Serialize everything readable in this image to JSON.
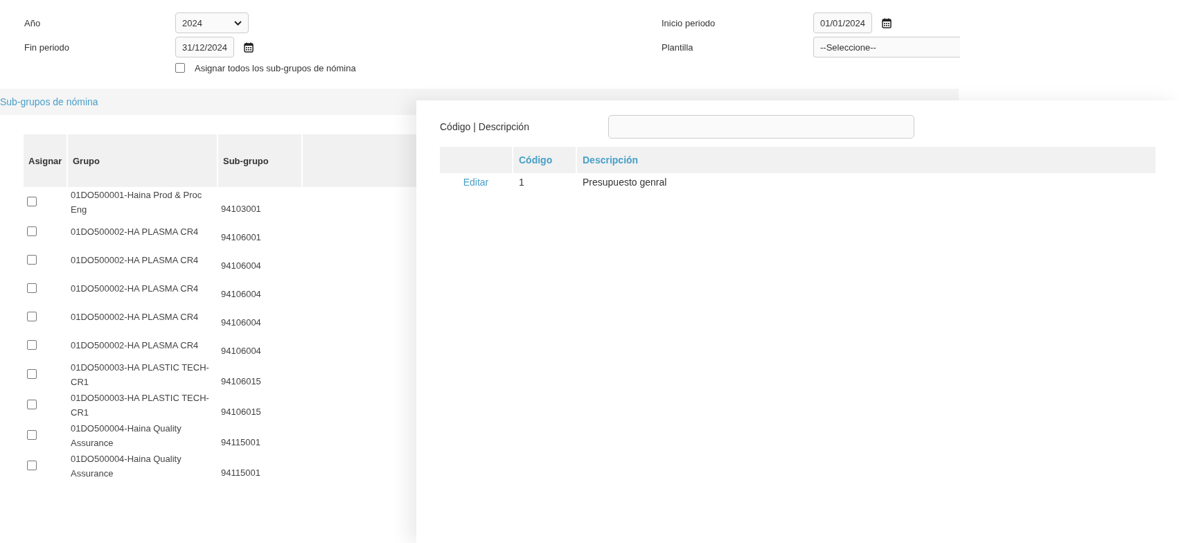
{
  "filters": {
    "year": {
      "label": "Año",
      "value": "2024"
    },
    "start": {
      "label": "Inicio periodo",
      "value": "01/01/2024"
    },
    "end": {
      "label": "Fin periodo",
      "value": "31/12/2024"
    },
    "template": {
      "label": "Plantilla",
      "value": "--Seleccione--"
    },
    "assign_all": {
      "label": "Asignar todos los sub-grupos de nómina",
      "checked": false
    }
  },
  "section": {
    "title": "Sub-grupos de nómina"
  },
  "sub_groups": {
    "columns": [
      "Asignar",
      "Grupo",
      "Sub-grupo"
    ],
    "rows": [
      {
        "checked": false,
        "group": "01DO500001-Haina Prod & Proc Eng",
        "subgroup": "94103001"
      },
      {
        "checked": false,
        "group": "01DO500002-HA PLASMA CR4",
        "subgroup": "94106001"
      },
      {
        "checked": false,
        "group": "01DO500002-HA PLASMA CR4",
        "subgroup": "94106004"
      },
      {
        "checked": false,
        "group": "01DO500002-HA PLASMA CR4",
        "subgroup": "94106004"
      },
      {
        "checked": false,
        "group": "01DO500002-HA PLASMA CR4",
        "subgroup": "94106004"
      },
      {
        "checked": false,
        "group": "01DO500002-HA PLASMA CR4",
        "subgroup": "94106004"
      },
      {
        "checked": false,
        "group": "01DO500003-HA PLASTIC TECH-CR1",
        "subgroup": "94106015"
      },
      {
        "checked": false,
        "group": "01DO500003-HA PLASTIC TECH-CR1",
        "subgroup": "94106015"
      },
      {
        "checked": false,
        "group": "01DO500004-Haina Quality Assurance",
        "subgroup": "94115001"
      },
      {
        "checked": false,
        "group": "01DO500004-Haina Quality Assurance",
        "subgroup": "94115001"
      }
    ]
  },
  "lookup": {
    "search": {
      "label": "Código | Descripción"
    },
    "columns": [
      "Código",
      "Descripción"
    ],
    "rows": [
      {
        "action": "Editar",
        "code": "1",
        "description": "Presupuesto genral"
      }
    ]
  }
}
